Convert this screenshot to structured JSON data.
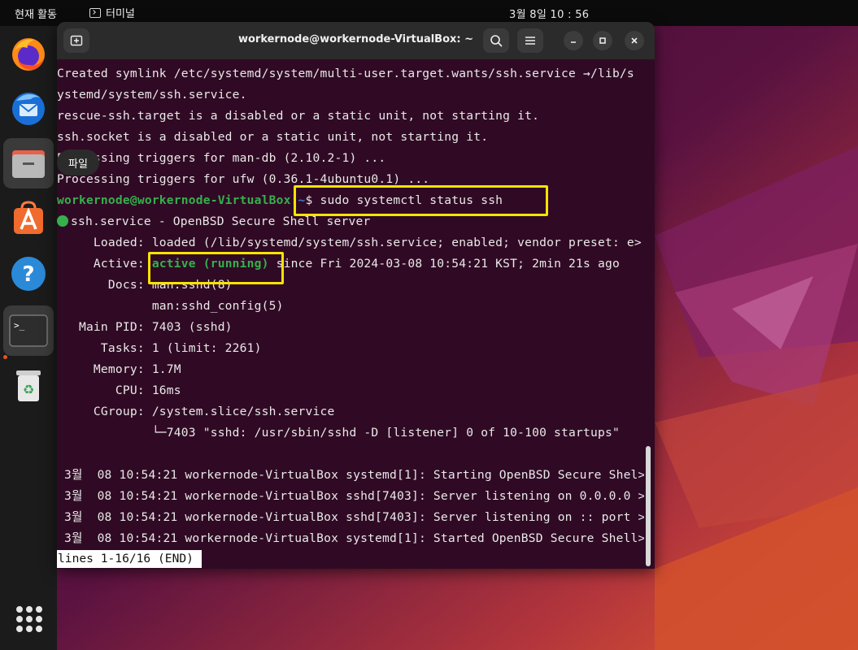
{
  "topbar": {
    "activities": "현재 활동",
    "app_name": "터미널",
    "clock": "3월 8일  10 : 56"
  },
  "dock": {
    "items": [
      {
        "name": "firefox-icon"
      },
      {
        "name": "thunderbird-icon"
      },
      {
        "name": "files-icon"
      },
      {
        "name": "app-center-icon"
      },
      {
        "name": "help-icon"
      },
      {
        "name": "terminal-icon"
      },
      {
        "name": "trash-icon"
      }
    ],
    "tooltip": "파일",
    "show_apps": "show-apps-icon"
  },
  "terminal": {
    "title": "workernode@workernode-VirtualBox: ~",
    "lines": [
      "Created symlink /etc/systemd/system/multi-user.target.wants/ssh.service →/lib/s",
      "ystemd/system/ssh.service.",
      "rescue-ssh.target is a disabled or a static unit, not starting it.",
      "ssh.socket is a disabled or a static unit, not starting it.",
      "Processing triggers for man-db (2.10.2-1) ...",
      "Processing triggers for ufw (0.36.1-4ubuntu0.1) ..."
    ],
    "prompt_user": "workernode@workernode-VirtualBox",
    "prompt_path": ":~",
    "command": "$ sudo systemctl status ssh",
    "service_line": "ssh.service - OpenBSD Secure Shell server",
    "loaded": "     Loaded: loaded (/lib/systemd/system/ssh.service; enabled; vendor preset: e>",
    "active_label": "     Active: ",
    "active_value": "active (running)",
    "active_rest": " since Fri 2024-03-08 10:54:21 KST; 2min 21s ago",
    "docs1": "       Docs: man:sshd(8)",
    "docs2": "             man:sshd_config(5)",
    "main_pid": "   Main PID: 7403 (sshd)",
    "tasks": "      Tasks: 1 (limit: 2261)",
    "memory": "     Memory: 1.7M",
    "cpu": "        CPU: 16ms",
    "cgroup": "     CGroup: /system.slice/ssh.service",
    "cgroup_child": "             └─7403 \"sshd: /usr/sbin/sshd -D [listener] 0 of 10-100 startups\"",
    "journal": [
      " 3월  08 10:54:21 workernode-VirtualBox systemd[1]: Starting OpenBSD Secure Shel>",
      " 3월  08 10:54:21 workernode-VirtualBox sshd[7403]: Server listening on 0.0.0.0 >",
      " 3월  08 10:54:21 workernode-VirtualBox sshd[7403]: Server listening on :: port >",
      " 3월  08 10:54:21 workernode-VirtualBox systemd[1]: Started OpenBSD Secure Shell>"
    ],
    "status_bar": "lines 1-16/16 (END)"
  },
  "colors": {
    "terminal_bg": "#300a24",
    "prompt_green": "#35b04d",
    "prompt_blue": "#3c7cd6",
    "highlight": "#f7e300"
  }
}
